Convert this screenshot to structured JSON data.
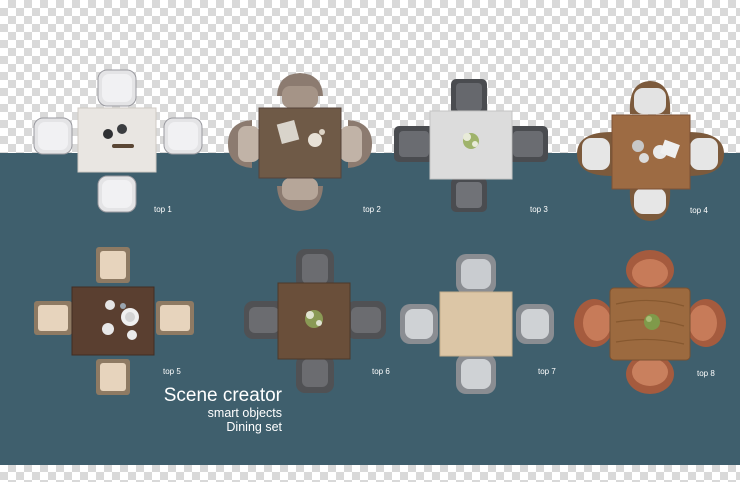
{
  "colors": {
    "panel": "#3f5f6d",
    "checker_light": "#ffffff",
    "checker_dark": "#d9d9d9",
    "label_text": "#ffffff"
  },
  "sets": [
    {
      "label": "top 1",
      "table": "marble-white",
      "chairs": "white-upholstered"
    },
    {
      "label": "top 2",
      "table": "dark-wood",
      "chairs": "taupe-shell"
    },
    {
      "label": "top 3",
      "table": "light-grey",
      "chairs": "charcoal-armchair"
    },
    {
      "label": "top 4",
      "table": "oak-wood",
      "chairs": "white-wood-frame"
    },
    {
      "label": "top 5",
      "table": "walnut-wood",
      "chairs": "beige-upholstered"
    },
    {
      "label": "top 6",
      "table": "walnut-wood",
      "chairs": "dark-grey-armchair"
    },
    {
      "label": "top 7",
      "table": "birch-wood",
      "chairs": "grey-shell"
    },
    {
      "label": "top 8",
      "table": "rough-oak",
      "chairs": "terracotta-leather"
    }
  ],
  "caption": {
    "title": "Scene creator",
    "line2": "smart objects",
    "line3": "Dining set"
  }
}
